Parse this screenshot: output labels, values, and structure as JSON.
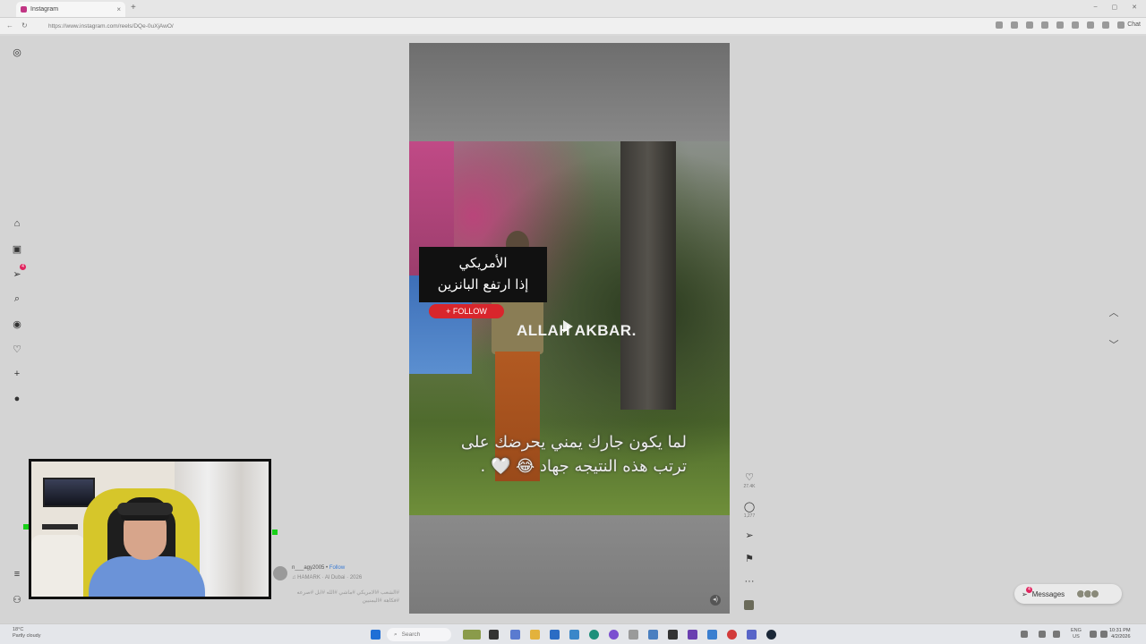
{
  "browser": {
    "tab_title": "Instagram",
    "tab_close": "×",
    "new_tab": "+",
    "window_controls": [
      "–",
      "▢",
      "✕"
    ],
    "url": "https://www.instagram.com/reels/DQe-0uXjAwO/",
    "chat_label": "Chat"
  },
  "sidebar": {
    "items": [
      {
        "icon": "instagram-logo-icon"
      },
      {
        "icon": "home-icon"
      },
      {
        "icon": "reels-icon"
      },
      {
        "icon": "messages-icon",
        "badge": "4"
      },
      {
        "icon": "search-icon"
      },
      {
        "icon": "explore-icon"
      },
      {
        "icon": "notifications-heart-icon"
      },
      {
        "icon": "create-plus-icon"
      },
      {
        "icon": "profile-avatar"
      },
      {
        "icon": "more-menu-icon"
      },
      {
        "icon": "also-from-meta-icon"
      }
    ]
  },
  "reel": {
    "overlay_ar_line1": "الأمريكي",
    "overlay_ar_line2": "إذا ارتفع البانزين",
    "follow_pill": "+ FOLLOW",
    "overlay_en": "ALLAH AKBAR.",
    "caption_line1": "لما يكون جارك يمني يحرضك على",
    "caption_line2": "ترتب هذه النتيجه جهاد 😂 🤍 .",
    "actions": {
      "likes": "27.4K",
      "comments": "1,277"
    }
  },
  "author": {
    "username": "n___agy2005",
    "separator": " • ",
    "follow": "Follow",
    "audio": "♫ HAMARK · Al Dubai · 2026",
    "description": "#الشعب #الامريكي #ماشي #الله #ابل #صرعه #فكاهة #اليمنيين"
  },
  "messages": {
    "label": "Messages",
    "badge": "4"
  },
  "taskbar": {
    "weather_temp": "18°C",
    "weather_desc": "Partly cloudy",
    "search_placeholder": "Search",
    "lang_line1": "ENG",
    "lang_line2": "US",
    "time": "10:31 PM",
    "date": "4/2/2026"
  },
  "colors": {
    "badge_red": "#e0245e",
    "follow_red": "#d8262c",
    "follow_blue": "#3a7bd5",
    "webcam_border": "#111111"
  }
}
